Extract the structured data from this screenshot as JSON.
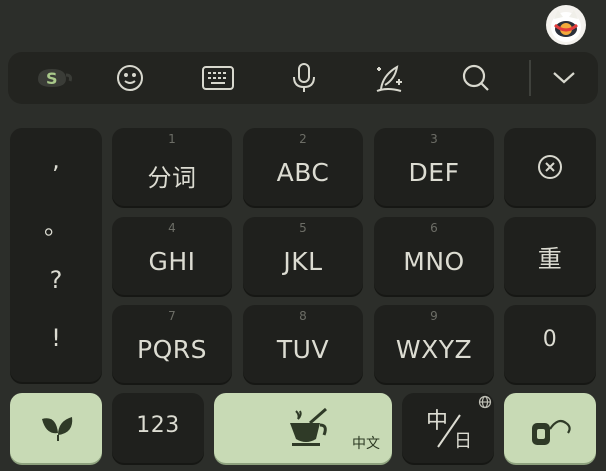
{
  "toolbar": {
    "icons": [
      "sogou-logo-icon",
      "emoji-icon",
      "keyboard-icon",
      "microphone-icon",
      "handwriting-icon",
      "search-icon",
      "chevron-down-icon"
    ]
  },
  "keys": {
    "row1": [
      {
        "num": "1",
        "label": "分词"
      },
      {
        "num": "2",
        "label": "ABC"
      },
      {
        "num": "3",
        "label": "DEF"
      }
    ],
    "row2": [
      {
        "num": "4",
        "label": "GHI"
      },
      {
        "num": "5",
        "label": "JKL"
      },
      {
        "num": "6",
        "label": "MNO"
      }
    ],
    "row3": [
      {
        "num": "7",
        "label": "PQRS"
      },
      {
        "num": "8",
        "label": "TUV"
      },
      {
        "num": "9",
        "label": "WXYZ"
      }
    ],
    "reenter_label": "重",
    "zero_label": "0",
    "numeric_label": "123",
    "space_sub_label": "中文",
    "lang_switch_top": "中",
    "lang_switch_bottom": "日"
  },
  "punctuation": [
    ",",
    "。",
    "?",
    "!"
  ],
  "colors": {
    "background": "#2c2e2a",
    "key": "#1f201d",
    "accent_green": "#c8dab5",
    "text": "#dcdcd2"
  }
}
